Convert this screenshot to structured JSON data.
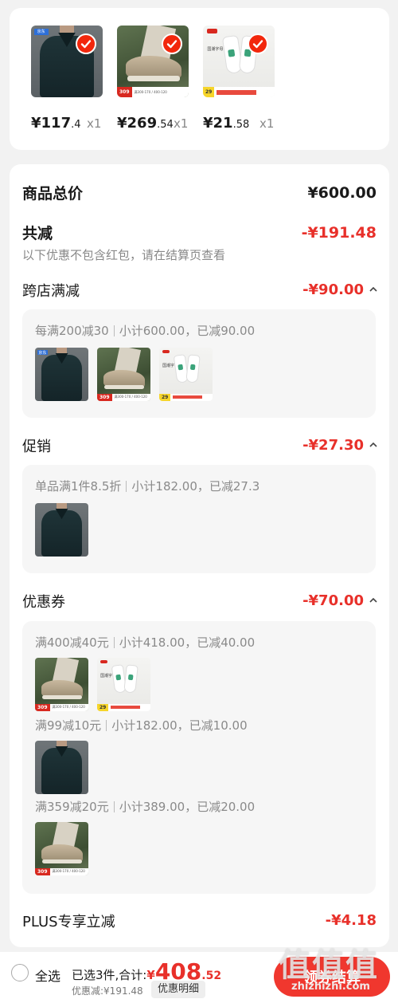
{
  "selected_items": [
    {
      "id": "shirt",
      "price_int": "¥117",
      "price_dec": ".4",
      "qty": "x1"
    },
    {
      "id": "shoe",
      "price_int": "¥269",
      "price_dec": ".54",
      "qty": "x1"
    },
    {
      "id": "sock",
      "price_int": "¥21",
      "price_dec": ".58",
      "qty": "x1"
    }
  ],
  "summary": {
    "total_label": "商品总价",
    "total_value": "¥600.00",
    "reduce_label": "共减",
    "reduce_value": "-¥191.48",
    "note": "以下优惠不包含红包，请在结算页查看"
  },
  "cross_store": {
    "label": "跨店满减",
    "amount": "-¥90.00",
    "rule": "每满200减30",
    "subtotal": "小计600.00，已减90.00"
  },
  "promotion": {
    "label": "促销",
    "amount": "-¥27.30",
    "rule": "单品满1件8.5折",
    "subtotal": "小计182.00，已减27.3"
  },
  "coupons": {
    "label": "优惠券",
    "amount": "-¥70.00",
    "groups": [
      {
        "rule": "满400减40元",
        "subtotal": "小计418.00，已减40.00"
      },
      {
        "rule": "满99减10元",
        "subtotal": "小计182.00，已减10.00"
      },
      {
        "rule": "满359减20元",
        "subtotal": "小计389.00，已减20.00"
      }
    ]
  },
  "plus": {
    "label": "PLUS专享立减",
    "amount": "-¥4.18"
  },
  "thumb_text": {
    "shirt_tag": "京东",
    "shoe_badge": "309",
    "shoe_badge_note": "满300-170 / 400-120",
    "sock_badge": "29",
    "sock_label": "国潮字母"
  },
  "bottom_bar": {
    "select_all": "全选",
    "selected_text": "已选3件,合计:",
    "currency": "¥",
    "total_int": "408",
    "total_dec": ".52",
    "discount_text": "优惠减:¥191.48",
    "detail_button": "优惠明细",
    "checkout_button": "领券结算"
  },
  "watermark": {
    "big": "值值值",
    "small": "zhizhizhi.com"
  },
  "colors": {
    "accent": "#e8302a",
    "checkout": "#f0372e",
    "background": "#f2f2f2"
  }
}
